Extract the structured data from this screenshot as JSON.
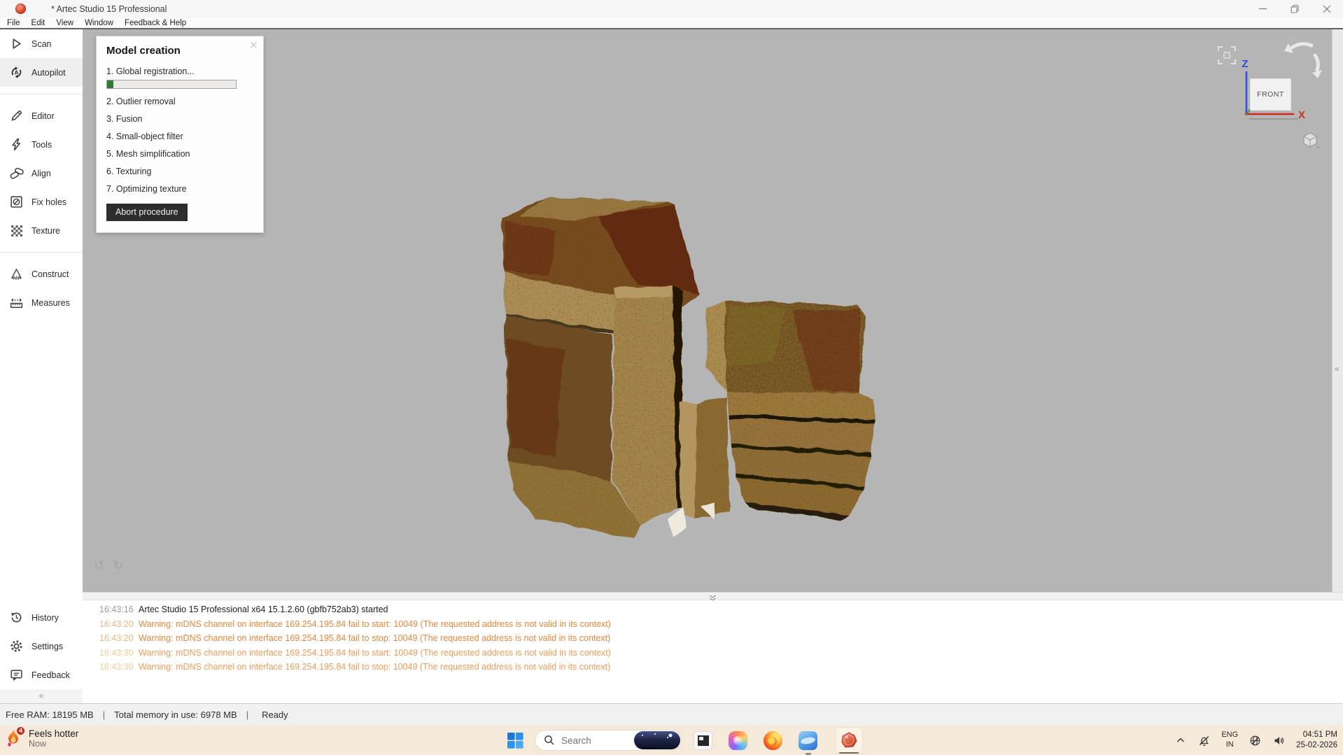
{
  "window": {
    "title": "* Artec Studio 15 Professional"
  },
  "menu": {
    "items": [
      "File",
      "Edit",
      "View",
      "Window",
      "Feedback & Help"
    ]
  },
  "sidebar": {
    "groups": [
      {
        "items": [
          {
            "icon": "scan",
            "label": "Scan"
          },
          {
            "icon": "autopilot",
            "label": "Autopilot",
            "selected": true
          }
        ]
      },
      {
        "items": [
          {
            "icon": "editor",
            "label": "Editor"
          },
          {
            "icon": "tools",
            "label": "Tools"
          },
          {
            "icon": "align",
            "label": "Align"
          },
          {
            "icon": "fix-holes",
            "label": "Fix holes"
          },
          {
            "icon": "texture",
            "label": "Texture"
          }
        ]
      },
      {
        "items": [
          {
            "icon": "construct",
            "label": "Construct"
          },
          {
            "icon": "measures",
            "label": "Measures"
          }
        ]
      }
    ],
    "bottom_items": [
      {
        "icon": "history",
        "label": "History"
      },
      {
        "icon": "settings",
        "label": "Settings"
      },
      {
        "icon": "feedback",
        "label": "Feedback"
      }
    ],
    "collapse_glyph": "«"
  },
  "model_creation_panel": {
    "title": "Model creation",
    "close_glyph": "×",
    "steps": [
      {
        "label": "1. Global registration...",
        "progress_percent": 5
      },
      {
        "label": "2. Outlier removal"
      },
      {
        "label": "3. Fusion"
      },
      {
        "label": "4. Small-object filter"
      },
      {
        "label": "5. Mesh simplification"
      },
      {
        "label": "6. Texturing"
      },
      {
        "label": "7. Optimizing texture"
      }
    ],
    "abort_label": "Abort procedure",
    "progress_color": "#2e7d32"
  },
  "viewport": {
    "view_cube": {
      "face_label": "FRONT",
      "x_label": "X",
      "z_label": "Z",
      "x_color": "#d02a1f",
      "z_color": "#2b50d6",
      "y_color": "#2f9e2f"
    },
    "undo_glyph": "↺",
    "redo_glyph": "↻",
    "right_strip_glyph": "«"
  },
  "log": {
    "warning_color": "#e6863a",
    "lines": [
      {
        "time": "16:43:16",
        "text": "Artec Studio 15 Professional x64 15.1.2.60 (gbfb752ab3) started",
        "type": "info"
      },
      {
        "time": "16:43:20",
        "text": "Warning: mDNS channel on interface 169.254.195.84 fail to start: 10049 (The requested address is not valid in its context)",
        "type": "warning"
      },
      {
        "time": "16:43:20",
        "text": "Warning: mDNS channel on interface 169.254.195.84 fail to stop: 10049 (The requested address is not valid in its context)",
        "type": "warning"
      },
      {
        "time": "16:43:30",
        "text": "Warning: mDNS channel on interface 169.254.195.84 fail to start: 10049 (The requested address is not valid in its context)",
        "type": "warning-faded"
      },
      {
        "time": "16:43:30",
        "text": "Warning: mDNS channel on interface 169.254.195.84 fail to stop: 10049 (The requested address is not valid in its context)",
        "type": "warning-faded"
      }
    ]
  },
  "status_bar": {
    "free_ram": "Free RAM: 18195 MB",
    "memory": "Total memory in use: 6978 MB",
    "state": "Ready",
    "divider": "|"
  },
  "taskbar": {
    "background": "#f5e9da",
    "weather": {
      "badge": "4",
      "title": "Feels hotter",
      "subtitle": "Now"
    },
    "search": {
      "placeholder": "Search"
    },
    "tray": {
      "lang_top": "ENG",
      "lang_bottom": "IN",
      "time": "04:51 PM",
      "date": "25-02-2026"
    }
  }
}
